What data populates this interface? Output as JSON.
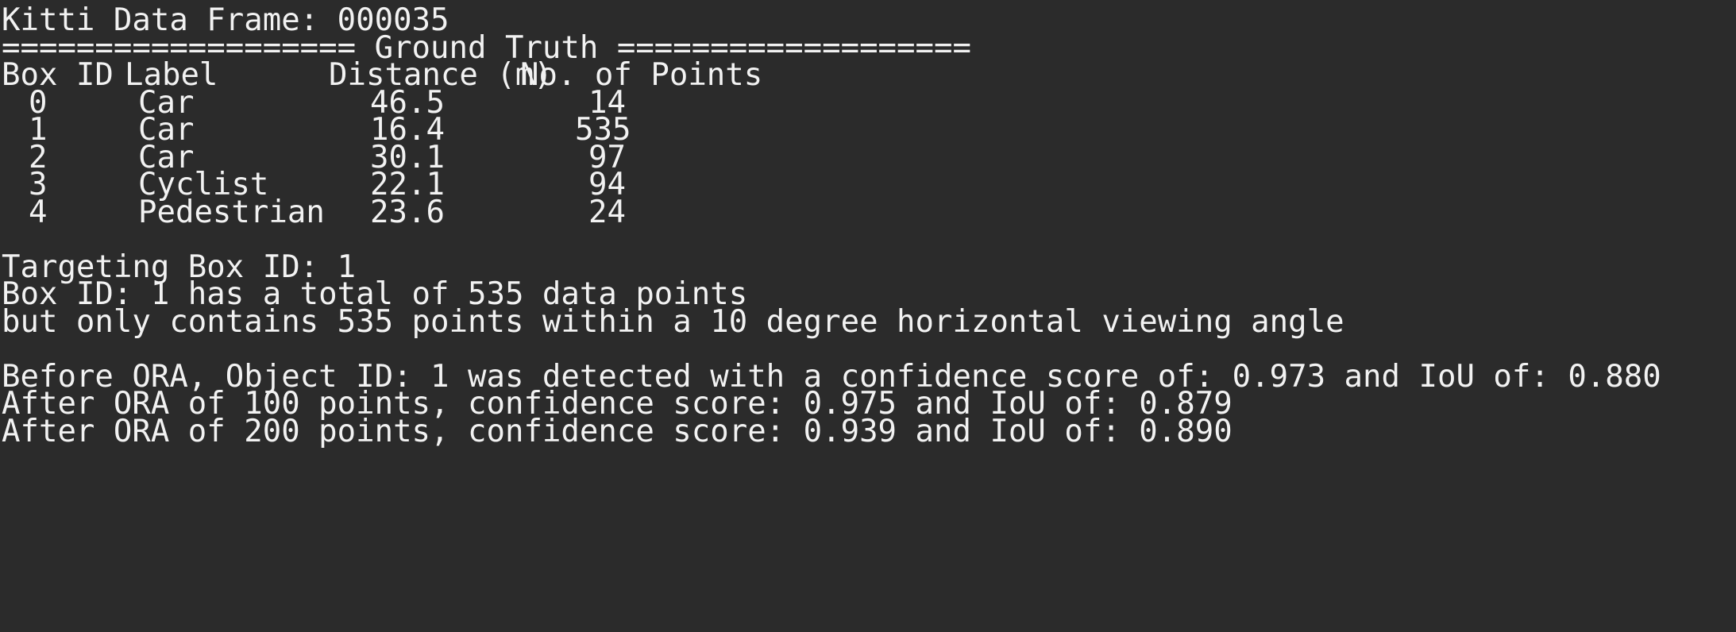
{
  "terminal": {
    "frame_line": "Kitti Data Frame: 000035",
    "section_header": "=================== Ground Truth ===================",
    "table": {
      "headers": [
        "Box ID",
        "Label",
        "Distance (m)",
        "No. of Points"
      ],
      "rows": [
        {
          "box_id": "0",
          "label": "Car",
          "distance": "46.5",
          "points": "14"
        },
        {
          "box_id": "1",
          "label": "Car",
          "distance": "16.4",
          "points": "535"
        },
        {
          "box_id": "2",
          "label": "Car",
          "distance": "30.1",
          "points": "97"
        },
        {
          "box_id": "3",
          "label": "Cyclist",
          "distance": "22.1",
          "points": "94"
        },
        {
          "box_id": "4",
          "label": "Pedestrian",
          "distance": "23.6",
          "points": "24"
        }
      ]
    },
    "targeting_line": "Targeting Box ID: 1",
    "total_points_line": "Box ID: 1 has a total of 535 data points",
    "viewing_angle_line": "but only contains 535 points within a 10 degree horizontal viewing angle",
    "before_ora_line": "Before ORA, Object ID: 1 was detected with a confidence score of: 0.973 and IoU of: 0.880",
    "after_ora_100_line": "After ORA of 100 points, confidence score: 0.975 and IoU of: 0.879",
    "after_ora_200_line": "After ORA of 200 points, confidence score: 0.939 and IoU of: 0.890"
  }
}
